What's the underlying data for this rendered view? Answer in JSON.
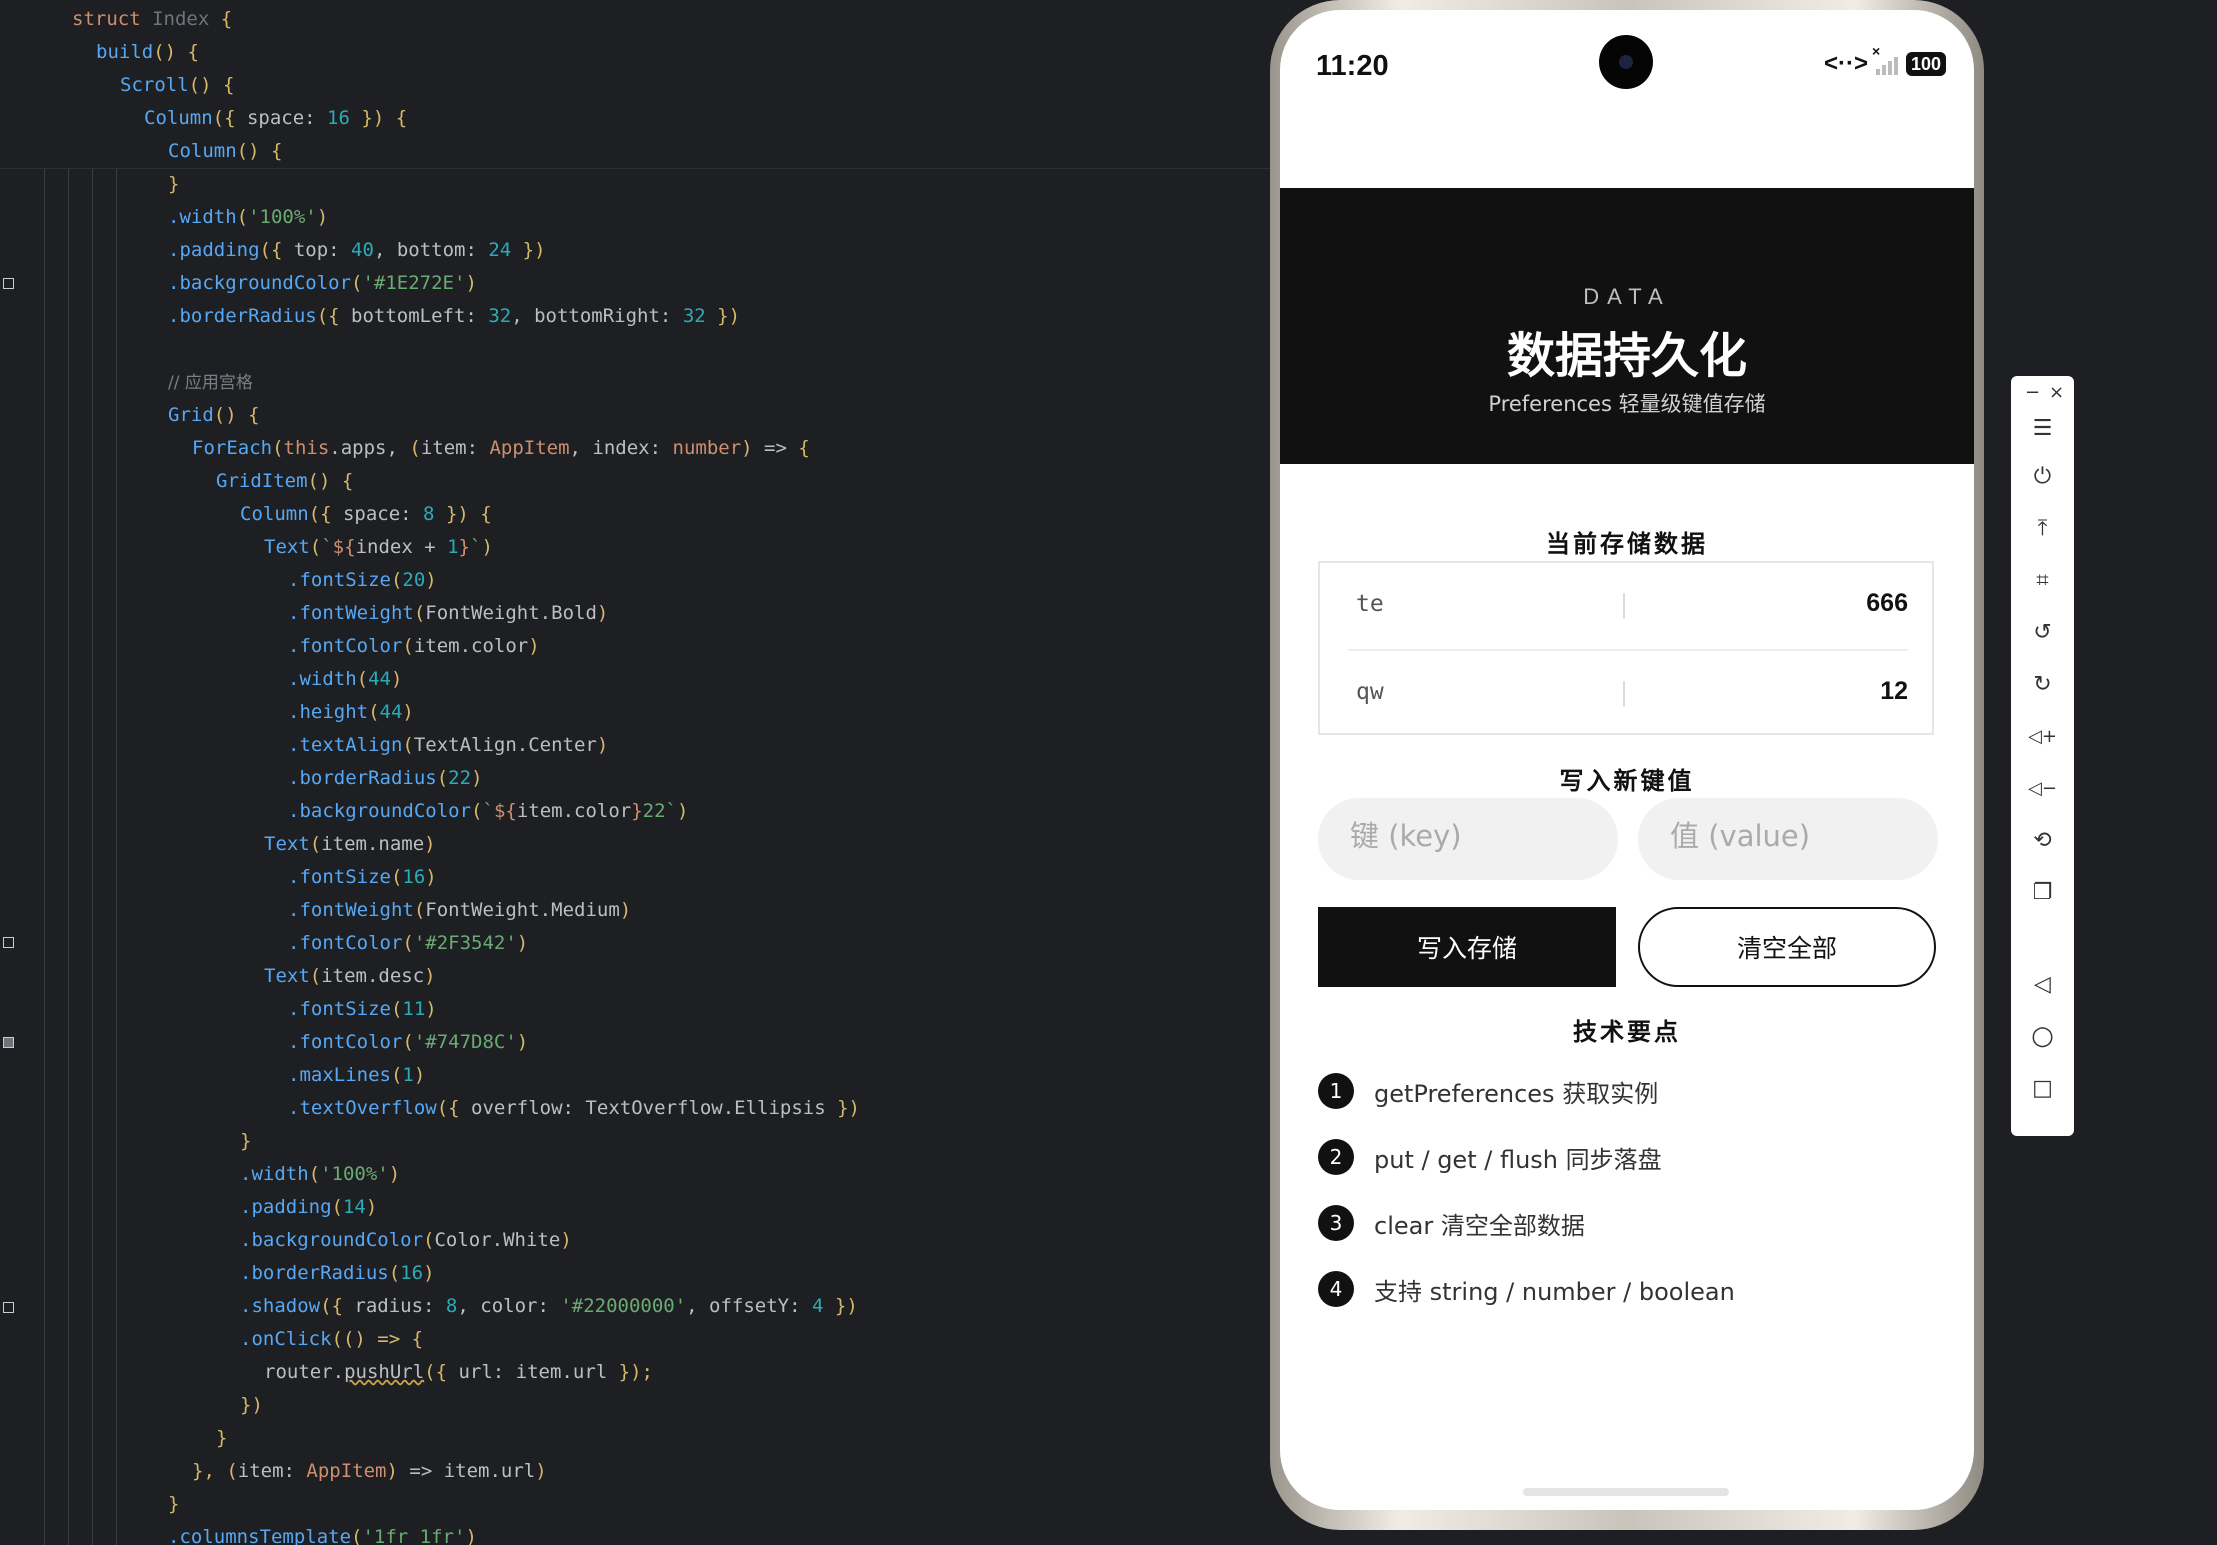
{
  "editor": {
    "sticky_lines": [
      [
        [
          "t-kw",
          "struct "
        ],
        [
          "t-cls",
          "Index "
        ],
        [
          "t-par",
          "{"
        ]
      ],
      [
        [
          "t-fn",
          "build"
        ],
        [
          "t-par",
          "() {"
        ]
      ],
      [
        [
          "t-fn",
          "Scroll"
        ],
        [
          "t-par",
          "() {"
        ]
      ],
      [
        [
          "t-fn",
          "Column"
        ],
        [
          "t-par",
          "({ "
        ],
        [
          "",
          "space: "
        ],
        [
          "t-num",
          "16"
        ],
        [
          "t-par",
          " }) {"
        ]
      ],
      [
        [
          "t-fn",
          "Column"
        ],
        [
          "t-par",
          "() {"
        ]
      ]
    ],
    "code_lines": [
      [
        [
          "t-par",
          "}"
        ]
      ],
      [
        [
          "t-fn",
          ".width"
        ],
        [
          "t-par",
          "("
        ],
        [
          "t-str",
          "'100%'"
        ],
        [
          "t-par",
          ")"
        ]
      ],
      [
        [
          "t-fn",
          ".padding"
        ],
        [
          "t-par",
          "({ "
        ],
        [
          "",
          "top: "
        ],
        [
          "t-num",
          "40"
        ],
        [
          "",
          ", bottom: "
        ],
        [
          "t-num",
          "24"
        ],
        [
          "t-par",
          " })"
        ]
      ],
      [
        [
          "t-fn",
          ".backgroundColor"
        ],
        [
          "t-par",
          "("
        ],
        [
          "t-str",
          "'#1E272E'"
        ],
        [
          "t-par",
          ")"
        ]
      ],
      [
        [
          "t-fn",
          ".borderRadius"
        ],
        [
          "t-par",
          "({ "
        ],
        [
          "",
          "bottomLeft: "
        ],
        [
          "t-num",
          "32"
        ],
        [
          "",
          ", bottomRight: "
        ],
        [
          "t-num",
          "32"
        ],
        [
          "t-par",
          " })"
        ]
      ],
      [],
      [
        [
          "t-cmt",
          "// 应用宫格"
        ]
      ],
      [
        [
          "t-fn",
          "Grid"
        ],
        [
          "t-par",
          "() {"
        ]
      ],
      [
        [
          "t-fn",
          "ForEach"
        ],
        [
          "t-par",
          "("
        ],
        [
          "t-this",
          "this"
        ],
        [
          "",
          ".apps, "
        ],
        [
          "t-par",
          "("
        ],
        [
          "",
          "item: "
        ],
        [
          "t-kw",
          "AppItem"
        ],
        [
          "",
          ", index: "
        ],
        [
          "t-kw",
          "number"
        ],
        [
          "t-par",
          ")"
        ],
        [
          "",
          " => "
        ],
        [
          "t-par",
          "{"
        ]
      ],
      [
        [
          "t-fn",
          "GridItem"
        ],
        [
          "t-par",
          "() {"
        ]
      ],
      [
        [
          "t-fn",
          "Column"
        ],
        [
          "t-par",
          "({ "
        ],
        [
          "",
          "space: "
        ],
        [
          "t-num",
          "8"
        ],
        [
          "t-par",
          " }) {"
        ]
      ],
      [
        [
          "t-fn",
          "Text"
        ],
        [
          "t-par",
          "("
        ],
        [
          "t-str",
          "`"
        ],
        [
          "t-kw",
          "${"
        ],
        [
          "",
          "index + "
        ],
        [
          "t-num",
          "1"
        ],
        [
          "t-kw",
          "}"
        ],
        [
          "t-str",
          "`"
        ],
        [
          "t-par",
          ")"
        ]
      ],
      [
        [
          "t-fn",
          ".fontSize"
        ],
        [
          "t-par",
          "("
        ],
        [
          "t-num",
          "20"
        ],
        [
          "t-par",
          ")"
        ]
      ],
      [
        [
          "t-fn",
          ".fontWeight"
        ],
        [
          "t-par",
          "("
        ],
        [
          "",
          "FontWeight.Bold"
        ],
        [
          "t-par",
          ")"
        ]
      ],
      [
        [
          "t-fn",
          ".fontColor"
        ],
        [
          "t-par",
          "("
        ],
        [
          "",
          "item.color"
        ],
        [
          "t-par",
          ")"
        ]
      ],
      [
        [
          "t-fn",
          ".width"
        ],
        [
          "t-par",
          "("
        ],
        [
          "t-num",
          "44"
        ],
        [
          "t-par",
          ")"
        ]
      ],
      [
        [
          "t-fn",
          ".height"
        ],
        [
          "t-par",
          "("
        ],
        [
          "t-num",
          "44"
        ],
        [
          "t-par",
          ")"
        ]
      ],
      [
        [
          "t-fn",
          ".textAlign"
        ],
        [
          "t-par",
          "("
        ],
        [
          "",
          "TextAlign.Center"
        ],
        [
          "t-par",
          ")"
        ]
      ],
      [
        [
          "t-fn",
          ".borderRadius"
        ],
        [
          "t-par",
          "("
        ],
        [
          "t-num",
          "22"
        ],
        [
          "t-par",
          ")"
        ]
      ],
      [
        [
          "t-fn",
          ".backgroundColor"
        ],
        [
          "t-par",
          "("
        ],
        [
          "t-str",
          "`"
        ],
        [
          "t-kw",
          "${"
        ],
        [
          "",
          "item.color"
        ],
        [
          "t-kw",
          "}"
        ],
        [
          "t-str",
          "22`"
        ],
        [
          "t-par",
          ")"
        ]
      ],
      [
        [
          "t-fn",
          "Text"
        ],
        [
          "t-par",
          "("
        ],
        [
          "",
          "item.name"
        ],
        [
          "t-par",
          ")"
        ]
      ],
      [
        [
          "t-fn",
          ".fontSize"
        ],
        [
          "t-par",
          "("
        ],
        [
          "t-num",
          "16"
        ],
        [
          "t-par",
          ")"
        ]
      ],
      [
        [
          "t-fn",
          ".fontWeight"
        ],
        [
          "t-par",
          "("
        ],
        [
          "",
          "FontWeight.Medium"
        ],
        [
          "t-par",
          ")"
        ]
      ],
      [
        [
          "t-fn",
          ".fontColor"
        ],
        [
          "t-par",
          "("
        ],
        [
          "t-str",
          "'#2F3542'"
        ],
        [
          "t-par",
          ")"
        ]
      ],
      [
        [
          "t-fn",
          "Text"
        ],
        [
          "t-par",
          "("
        ],
        [
          "",
          "item.desc"
        ],
        [
          "t-par",
          ")"
        ]
      ],
      [
        [
          "t-fn",
          ".fontSize"
        ],
        [
          "t-par",
          "("
        ],
        [
          "t-num",
          "11"
        ],
        [
          "t-par",
          ")"
        ]
      ],
      [
        [
          "t-fn",
          ".fontColor"
        ],
        [
          "t-par",
          "("
        ],
        [
          "t-str",
          "'#747D8C'"
        ],
        [
          "t-par",
          ")"
        ]
      ],
      [
        [
          "t-fn",
          ".maxLines"
        ],
        [
          "t-par",
          "("
        ],
        [
          "t-num",
          "1"
        ],
        [
          "t-par",
          ")"
        ]
      ],
      [
        [
          "t-fn",
          ".textOverflow"
        ],
        [
          "t-par",
          "({ "
        ],
        [
          "",
          "overflow: TextOverflow.Ellipsis"
        ],
        [
          "t-par",
          " })"
        ]
      ],
      [
        [
          "t-par",
          "}"
        ]
      ],
      [
        [
          "t-fn",
          ".width"
        ],
        [
          "t-par",
          "("
        ],
        [
          "t-str",
          "'100%'"
        ],
        [
          "t-par",
          ")"
        ]
      ],
      [
        [
          "t-fn",
          ".padding"
        ],
        [
          "t-par",
          "("
        ],
        [
          "t-num",
          "14"
        ],
        [
          "t-par",
          ")"
        ]
      ],
      [
        [
          "t-fn",
          ".backgroundColor"
        ],
        [
          "t-par",
          "("
        ],
        [
          "",
          "Color.White"
        ],
        [
          "t-par",
          ")"
        ]
      ],
      [
        [
          "t-fn",
          ".borderRadius"
        ],
        [
          "t-par",
          "("
        ],
        [
          "t-num",
          "16"
        ],
        [
          "t-par",
          ")"
        ]
      ],
      [
        [
          "t-fn",
          ".shadow"
        ],
        [
          "t-par",
          "({ "
        ],
        [
          "",
          "radius: "
        ],
        [
          "t-num",
          "8"
        ],
        [
          "",
          ", color: "
        ],
        [
          "t-str",
          "'#22000000'"
        ],
        [
          "",
          ", offsetY: "
        ],
        [
          "t-num",
          "4"
        ],
        [
          "t-par",
          " })"
        ]
      ],
      [
        [
          "t-fn",
          ".onClick"
        ],
        [
          "t-par",
          "(() => {"
        ]
      ],
      [
        [
          "",
          "router."
        ],
        [
          "t-warn",
          "pushUrl"
        ],
        [
          "t-par",
          "({ "
        ],
        [
          "",
          "url: item.url "
        ],
        [
          "t-par",
          "});"
        ]
      ],
      [
        [
          "t-par",
          "})"
        ]
      ],
      [
        [
          "t-par",
          "}"
        ]
      ],
      [
        [
          "t-par",
          "}, "
        ],
        [
          "t-par",
          "("
        ],
        [
          "",
          "item: "
        ],
        [
          "t-kw",
          "AppItem"
        ],
        [
          "t-par",
          ")"
        ],
        [
          "",
          " => item.url"
        ],
        [
          "t-par",
          ")"
        ]
      ],
      [
        [
          "t-par",
          "}"
        ]
      ],
      [
        [
          "t-fn",
          ".columnsTemplate"
        ],
        [
          "t-par",
          "("
        ],
        [
          "t-str",
          "'1fr 1fr'"
        ],
        [
          "t-par",
          ")"
        ]
      ]
    ]
  },
  "phone": {
    "status_bar": {
      "time": "11:20",
      "nfc": "<··>",
      "signal_x": "×",
      "battery": "100"
    },
    "hero": {
      "eyebrow": "DATA",
      "title": "数据持久化",
      "subtitle": "Preferences 轻量级键值存储"
    },
    "stored_section": {
      "title": "当前存储数据",
      "rows": [
        {
          "key": "te",
          "value": "666"
        },
        {
          "key": "qw",
          "value": "12"
        }
      ]
    },
    "write_section": {
      "title": "写入新键值",
      "key_placeholder": "键 (key)",
      "value_placeholder": "值 (value)",
      "write_button": "写入存储",
      "clear_button": "清空全部"
    },
    "tips_section": {
      "title": "技术要点",
      "items": [
        {
          "num": "1",
          "text": "getPreferences 获取实例"
        },
        {
          "num": "2",
          "text": "put / get / flush 同步落盘"
        },
        {
          "num": "3",
          "text": "clear 清空全部数据"
        },
        {
          "num": "4",
          "text": "支持 string / number / boolean"
        }
      ]
    }
  },
  "toolbar": {
    "minimize": "−",
    "close": "×",
    "menu": "☰",
    "power": "⏻",
    "pin_top": "⤒",
    "crop": "⌗",
    "rotate_left": "↺",
    "rotate_right": "↻",
    "volume_up": "◁+",
    "volume_down": "◁−",
    "shake": "⟲",
    "multi_screen": "❐",
    "back": "◁",
    "home": "○",
    "recents": "□"
  },
  "colors": {
    "editor_bg": "#1e1f22",
    "hero_bg": "#111111",
    "primary_button": "#111111"
  }
}
